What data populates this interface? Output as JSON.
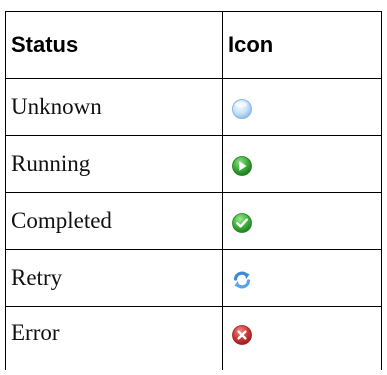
{
  "table": {
    "headers": [
      "Status",
      "Icon"
    ],
    "rows": [
      {
        "status": "Unknown",
        "icon": "unknown-status-icon"
      },
      {
        "status": "Running",
        "icon": "running-status-icon"
      },
      {
        "status": "Completed",
        "icon": "completed-status-icon"
      },
      {
        "status": "Retry",
        "icon": "retry-status-icon"
      },
      {
        "status": "Error",
        "icon": "error-status-icon"
      }
    ]
  },
  "colors": {
    "border": "#000000",
    "unknown": "#a9cff2",
    "running": "#2fa336",
    "completed": "#3fb23f",
    "retry": "#3d8ad8",
    "error": "#d42f2f"
  }
}
